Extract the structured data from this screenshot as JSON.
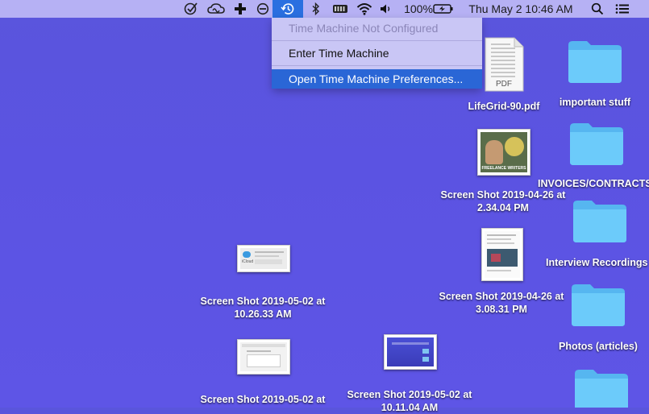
{
  "menubar": {
    "battery_percent": "100%",
    "clock": "Thu May 2  10:46 AM",
    "icons": [
      "checkmark-circle-icon",
      "creative-cloud-icon",
      "plus-icon",
      "do-not-disturb-icon",
      "time-machine-icon",
      "bluetooth-icon",
      "battery-meter-icon",
      "wifi-icon",
      "volume-icon",
      "battery-icon",
      "spotlight-search-icon",
      "notification-center-icon"
    ]
  },
  "time_machine_menu": {
    "items": [
      {
        "label": "Time Machine Not Configured",
        "enabled": false
      },
      {
        "label": "Enter Time Machine",
        "enabled": true
      },
      {
        "label": "Open Time Machine Preferences...",
        "enabled": true,
        "highlighted": true
      }
    ]
  },
  "desktop": {
    "files": [
      {
        "name": "LifeGrid-90.pdf",
        "type": "pdf",
        "badge": "PDF"
      },
      {
        "name_line1": "Screen Shot 2019-04-26 at",
        "name_line2": "2.34.04 PM",
        "meme_text": "FREELANCE WRITERS"
      },
      {
        "name_line1": "Screen Shot 2019-04-26 at",
        "name_line2": "3.08.31 PM"
      },
      {
        "name_line1": "Screen Shot 2019-05-02 at",
        "name_line2": "10.26.33 AM",
        "thumb_text": "iCloud"
      },
      {
        "name_line1": "Screen Shot 2019-05-02 at",
        "name_line2": ""
      },
      {
        "name_line1": "Screen Shot 2019-05-02 at",
        "name_line2": "10.11.04 AM"
      }
    ],
    "folders": [
      {
        "name": "important stuff"
      },
      {
        "name": "INVOICES/CONTRACTS"
      },
      {
        "name": "Interview Recordings"
      },
      {
        "name": "Photos (articles)"
      },
      {
        "name": ""
      }
    ]
  }
}
